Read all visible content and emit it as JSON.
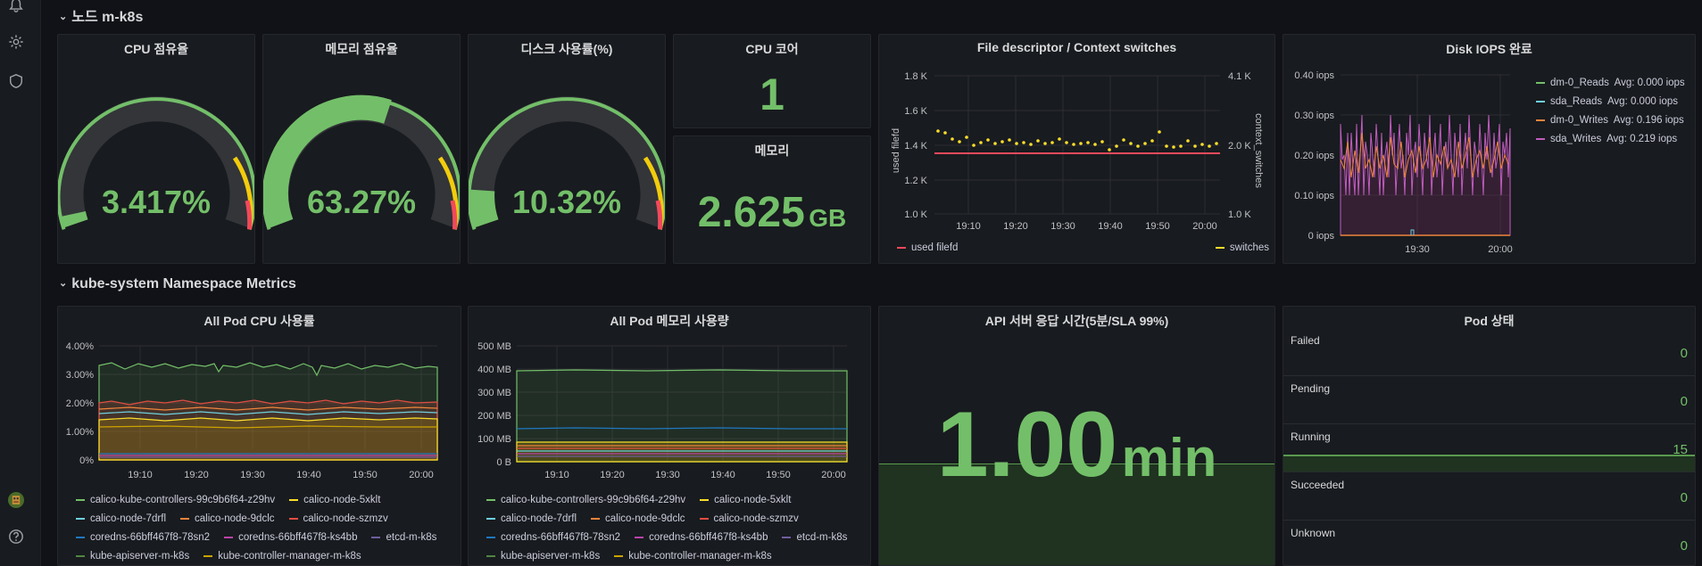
{
  "sidebar": {
    "icons": [
      "bell-icon",
      "gear-icon",
      "shield-icon",
      "avatar",
      "help-icon"
    ]
  },
  "rows": {
    "node": "노드 m-k8s",
    "kube": "kube-system Namespace Metrics"
  },
  "panels": {
    "cpu": {
      "title": "CPU 점유율",
      "value": "3.417%",
      "percent": 3.417
    },
    "mem": {
      "title": "메모리 점유율",
      "value": "63.27%",
      "percent": 63.27
    },
    "disk": {
      "title": "디스크 사용률(%)",
      "value": "10.32%",
      "percent": 10.32
    },
    "cores": {
      "title": "CPU 코어",
      "value": "1"
    },
    "memory": {
      "title": "메모리",
      "value": "2.625",
      "unit": "GB"
    },
    "fd": {
      "title": "File descriptor / Context switches",
      "left_axis_label": "used filefd",
      "right_axis_label": "context_switches",
      "left_ticks": [
        "1.8 K",
        "1.6 K",
        "1.4 K",
        "1.2 K",
        "1.0 K"
      ],
      "right_ticks": [
        "4.1 K",
        "2.0 K",
        "1.0 K"
      ],
      "x_ticks": [
        "19:10",
        "19:20",
        "19:30",
        "19:40",
        "19:50",
        "20:00"
      ],
      "legend_left": "used filefd",
      "legend_right": "switches"
    },
    "iops": {
      "title": "Disk IOPS 완료",
      "y_ticks": [
        "0.40 iops",
        "0.30 iops",
        "0.20 iops",
        "0.10 iops",
        "0 iops"
      ],
      "x_ticks": [
        "19:30",
        "20:00"
      ],
      "legend": [
        {
          "name": "dm-0_Reads",
          "avg": "Avg: 0.000 iops",
          "color": "#73bf69"
        },
        {
          "name": "sda_Reads",
          "avg": "Avg: 0.000 iops",
          "color": "#6ed0e0"
        },
        {
          "name": "dm-0_Writes",
          "avg": "Avg: 0.196 iops",
          "color": "#ef843c"
        },
        {
          "name": "sda_Writes",
          "avg": "Avg: 0.219 iops",
          "color": "#c15cc0"
        }
      ]
    },
    "podcpu": {
      "title": "All Pod CPU 사용률",
      "y_ticks": [
        "4.00%",
        "3.00%",
        "2.00%",
        "1.00%",
        "0%"
      ],
      "x_ticks": [
        "19:10",
        "19:20",
        "19:30",
        "19:40",
        "19:50",
        "20:00"
      ]
    },
    "podmem": {
      "title": "All Pod 메모리 사용량",
      "y_ticks": [
        "500 MB",
        "400 MB",
        "300 MB",
        "200 MB",
        "100 MB",
        "0 B"
      ],
      "x_ticks": [
        "19:10",
        "19:20",
        "19:30",
        "19:40",
        "19:50",
        "20:00"
      ]
    },
    "api": {
      "title": "API 서버 응답 시간(5분/SLA 99%)",
      "value": "1.00",
      "unit": "min"
    },
    "pod": {
      "title": "Pod 상태",
      "rows": [
        {
          "label": "Failed",
          "value": "0"
        },
        {
          "label": "Pending",
          "value": "0"
        },
        {
          "label": "Running",
          "value": "15"
        },
        {
          "label": "Succeeded",
          "value": "0"
        },
        {
          "label": "Unknown",
          "value": "0"
        }
      ]
    }
  },
  "pod_legend": [
    [
      {
        "name": "calico-kube-controllers-99c9b6f64-z29hv",
        "color": "#73bf69"
      },
      {
        "name": "calico-node-5xklt",
        "color": "#fade2a"
      }
    ],
    [
      {
        "name": "calico-node-7drfl",
        "color": "#6ed0e0"
      },
      {
        "name": "calico-node-9dclc",
        "color": "#ef843c"
      },
      {
        "name": "calico-node-szmzv",
        "color": "#e24d42"
      }
    ],
    [
      {
        "name": "coredns-66bff467f8-78sn2",
        "color": "#1f78c1"
      },
      {
        "name": "coredns-66bff467f8-ks4bb",
        "color": "#ba43a9"
      },
      {
        "name": "etcd-m-k8s",
        "color": "#705da0"
      }
    ],
    [
      {
        "name": "kube-apiserver-m-k8s",
        "color": "#508642"
      },
      {
        "name": "kube-controller-manager-m-k8s",
        "color": "#cca300"
      }
    ]
  ]
}
